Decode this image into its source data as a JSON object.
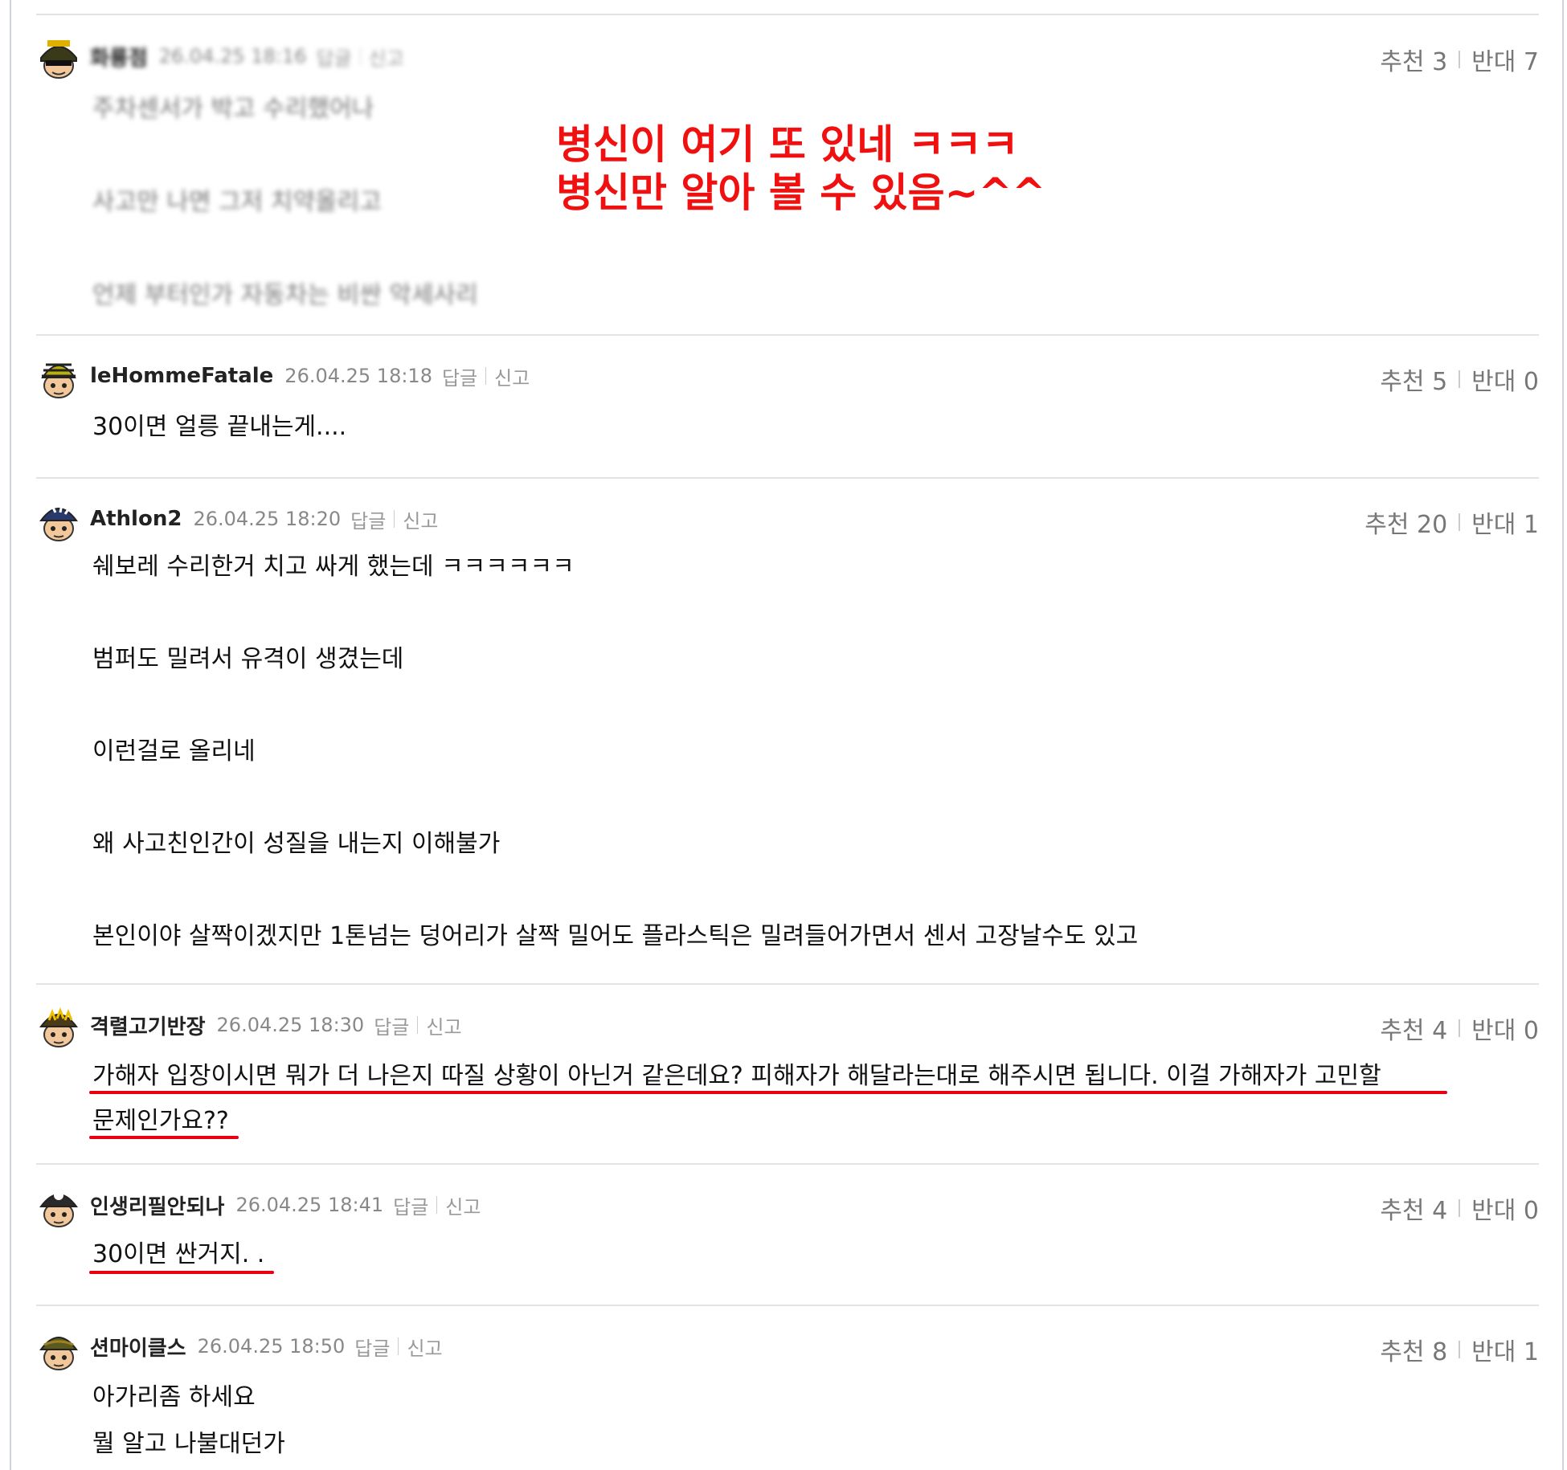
{
  "comments": [
    {
      "author": "화룡점",
      "date": "26.04.25 18:16",
      "reply": "답글",
      "report": "신고",
      "up_label": "추천 3",
      "down_label": "반대 7",
      "lines": [
        "주차센서가 박고 수리했어나",
        "사고만 나면 그저 치약올리고",
        "언제 부터인가 자동차는 비싼 악세사리"
      ]
    },
    {
      "author": "leHommeFatale",
      "date": "26.04.25 18:18",
      "reply": "답글",
      "report": "신고",
      "up_label": "추천 5",
      "down_label": "반대 0",
      "lines": [
        "30이면 얼릉 끝내는게...."
      ]
    },
    {
      "author": "Athlon2",
      "date": "26.04.25 18:20",
      "reply": "답글",
      "report": "신고",
      "up_label": "추천 20",
      "down_label": "반대 1",
      "lines": [
        "쉐보레 수리한거 치고 싸게 했는데 ㅋㅋㅋㅋㅋㅋ",
        "범퍼도 밀려서 유격이 생겼는데",
        "이런걸로 올리네",
        "왜 사고친인간이 성질을 내는지 이해불가",
        "본인이야 살짝이겠지만 1톤넘는 덩어리가 살짝 밀어도 플라스틱은 밀려들어가면서 센서 고장날수도 있고"
      ]
    },
    {
      "author": "격렬고기반장",
      "date": "26.04.25 18:30",
      "reply": "답글",
      "report": "신고",
      "up_label": "추천 4",
      "down_label": "반대 0",
      "lines": [
        "가해자 입장이시면 뭐가 더 나은지 따질 상황이 아닌거 같은데요? 피해자가 해달라는대로 해주시면 됩니다. 이걸 가해자가 고민할",
        "문제인가요??"
      ]
    },
    {
      "author": "인생리필안되나",
      "date": "26.04.25 18:41",
      "reply": "답글",
      "report": "신고",
      "up_label": "추천 4",
      "down_label": "반대 0",
      "lines": [
        "30이면 싼거지. ."
      ]
    },
    {
      "author": "션마이클스",
      "date": "26.04.25 18:50",
      "reply": "답글",
      "report": "신고",
      "up_label": "추천 8",
      "down_label": "반대 1",
      "lines": [
        "아가리좀 하세요",
        "뭘 알고 나불대던가"
      ]
    }
  ],
  "annotation": {
    "line1": "병신이 여기 또 있네 ㅋㅋㅋ",
    "line2": "병신만 알아 볼 수 있음~^^",
    "color": "#f01010"
  },
  "colors": {
    "underline": "#e60012",
    "divider": "#e3e3e3",
    "meta_text": "#888888",
    "vote_text": "#777777"
  },
  "icons": {
    "avatar": "character-avatar-icon"
  }
}
